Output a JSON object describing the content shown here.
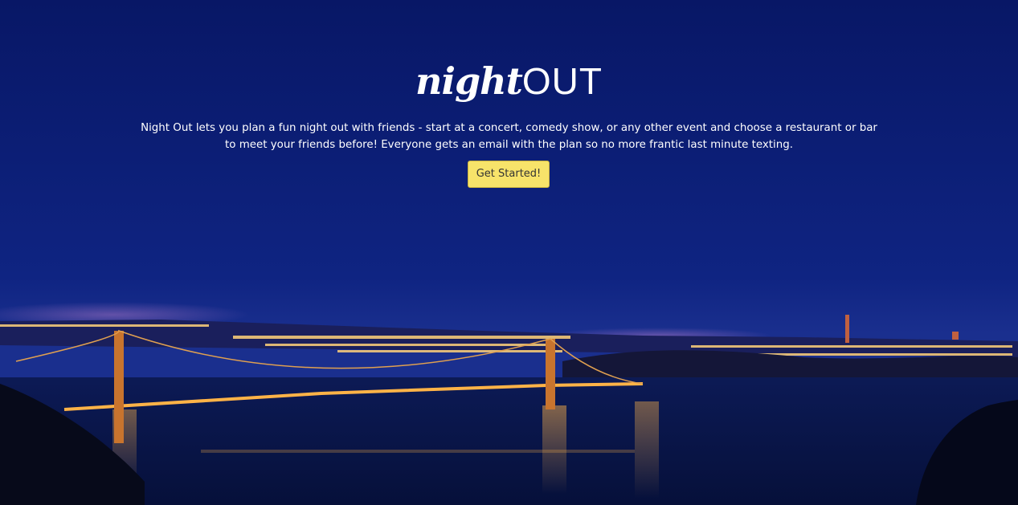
{
  "hero": {
    "logo_part1": "night",
    "logo_part2": "OUT",
    "tagline": "Night Out lets you plan a fun night out with friends - start at a concert, comedy show, or any other event and choose a restaurant or bar to meet your friends before! Everyone gets an email with the plan so no more frantic last minute texting.",
    "cta_label": "Get Started!",
    "background": "night-city-bridge-photo"
  },
  "colors": {
    "sky": "#0c1a6e",
    "cta_background": "#f7e36a",
    "text": "#ffffff"
  }
}
